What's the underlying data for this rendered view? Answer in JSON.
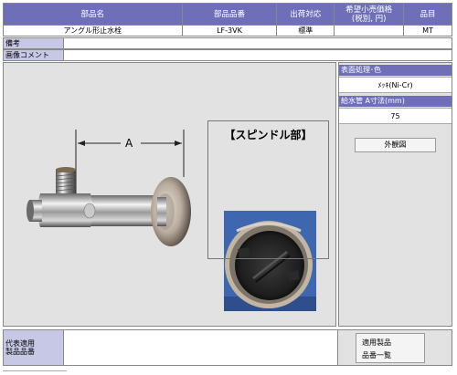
{
  "header": {
    "col_part_name": "部品名",
    "col_part_number": "部品品番",
    "col_shipping": "出荷対応",
    "col_price": "希望小売価格\n(税別, 円)",
    "col_item": "品目"
  },
  "part": {
    "name": "アングル形止水栓",
    "number": "LF-3VK",
    "shipping": "標準",
    "price": "",
    "item": "MT"
  },
  "notes": {
    "remarks_label": "備考",
    "remarks_value": "",
    "image_comment_label": "画像コメント",
    "image_comment_value": ""
  },
  "image": {
    "dimension_label": "A",
    "spindle_label": "【スピンドル部】"
  },
  "specs": {
    "surface_label": "表面処理･色",
    "surface_value": "ﾒｯｷ(Ni-Cr)",
    "supply_pipe_label": "給水管 A寸法(mm)",
    "supply_pipe_value": "75"
  },
  "buttons": {
    "exterior_view": "外観図",
    "applicable_products_line1": "適用製品",
    "applicable_products_line2": "品番一覧"
  },
  "footer": {
    "representative_label_line1": "代表適用",
    "representative_label_line2": "製品品番",
    "representative_value": ""
  },
  "colors": {
    "header_bg": "#6f6fb9",
    "label_bg": "#c7c7e6",
    "panel_bg": "#e2e2e2"
  }
}
